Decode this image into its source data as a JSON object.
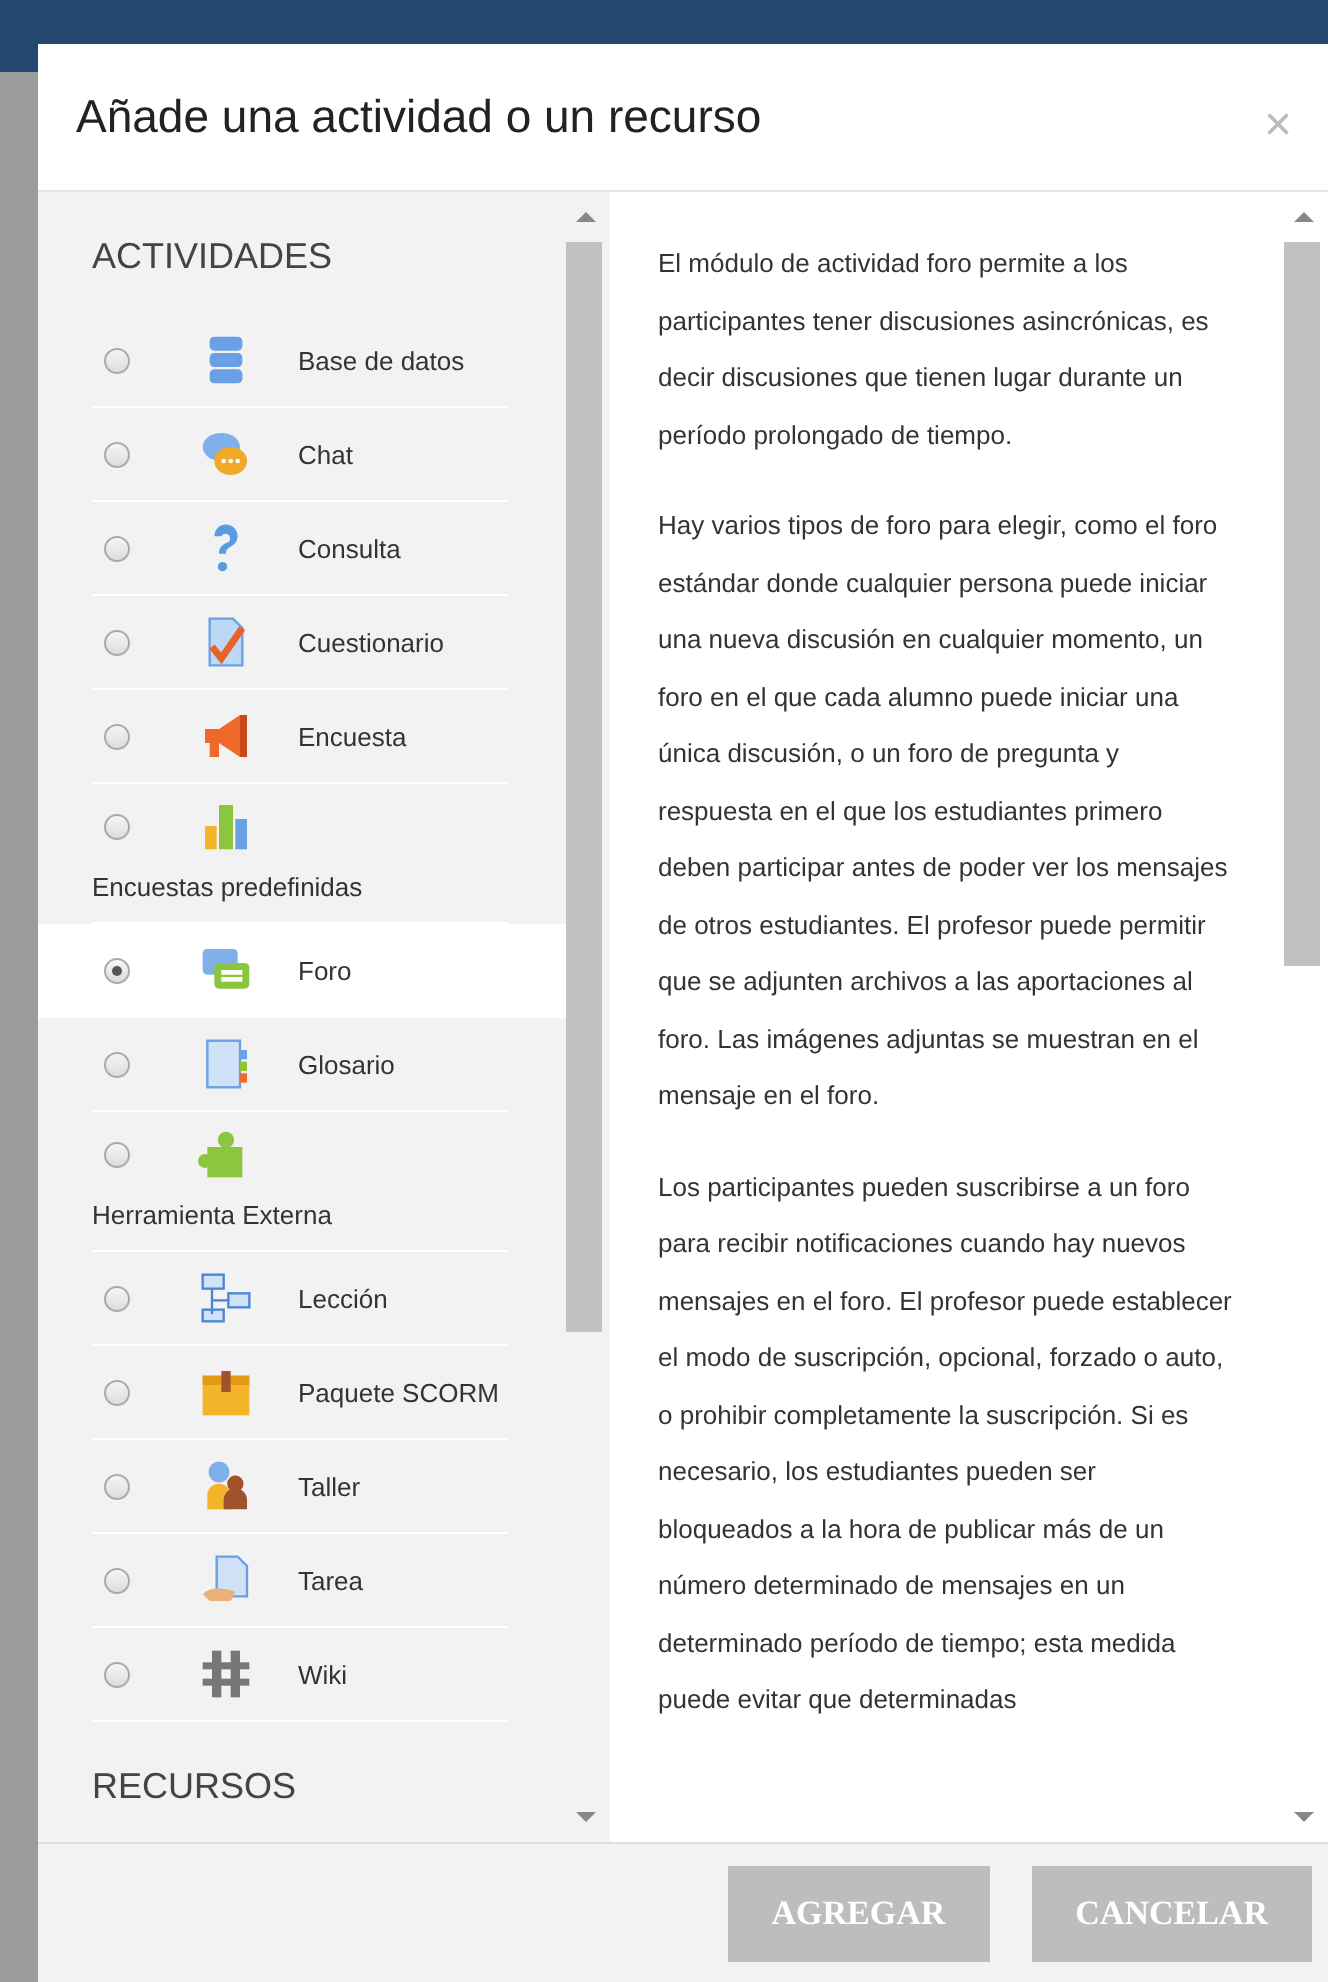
{
  "dialog": {
    "title": "Añade una actividad o un recurso",
    "close": "×"
  },
  "sections": [
    {
      "title": "ACTIVIDADES",
      "items": [
        {
          "label": "Base de datos",
          "kind": "inline",
          "selected": false
        },
        {
          "label": "Chat",
          "kind": "inline",
          "selected": false
        },
        {
          "label": "Consulta",
          "kind": "inline",
          "selected": false
        },
        {
          "label": "Cuestionario",
          "kind": "inline",
          "selected": false
        },
        {
          "label": "Encuesta",
          "kind": "inline",
          "selected": false
        },
        {
          "label": "Encuestas predefinidas",
          "kind": "wrapped",
          "selected": false
        },
        {
          "label": "Foro",
          "kind": "inline",
          "selected": true
        },
        {
          "label": "Glosario",
          "kind": "inline",
          "selected": false
        },
        {
          "label": "Herramienta Externa",
          "kind": "wrapped",
          "selected": false
        },
        {
          "label": "Lección",
          "kind": "inline",
          "selected": false
        },
        {
          "label": "Paquete SCORM",
          "kind": "inline",
          "selected": false
        },
        {
          "label": "Taller",
          "kind": "inline",
          "selected": false
        },
        {
          "label": "Tarea",
          "kind": "inline",
          "selected": false
        },
        {
          "label": "Wiki",
          "kind": "inline",
          "selected": false
        }
      ]
    },
    {
      "title": "RECURSOS"
    }
  ],
  "description": [
    "El módulo de actividad foro permite a los participantes tener discusiones asincrónicas, es decir discusiones que tienen lugar durante un período prolongado de tiempo.",
    "Hay varios tipos de foro para elegir, como el foro estándar donde cualquier persona puede iniciar una nueva discusión en cualquier momento, un foro en el que cada alumno puede iniciar una única discusión, o un foro de pregunta y respuesta en el que los estudiantes primero deben participar antes de poder ver los mensajes de otros estudiantes. El profesor puede permitir que se adjunten archivos a las aportaciones al foro. Las imágenes adjuntas se muestran en el mensaje en el foro.",
    "Los participantes pueden suscribirse a un foro para recibir notificaciones cuando hay nuevos mensajes en el foro. El profesor puede establecer el modo de suscripción, opcional, forzado o auto, o prohibir completamente la suscripción. Si es necesario, los estudiantes pueden ser bloqueados a la hora de publicar más de un número determinado de mensajes en un determinado período de tiempo; esta medida puede evitar que determinadas"
  ],
  "buttons": [
    {
      "label": "AGREGAR"
    },
    {
      "label": "CANCELAR"
    }
  ]
}
